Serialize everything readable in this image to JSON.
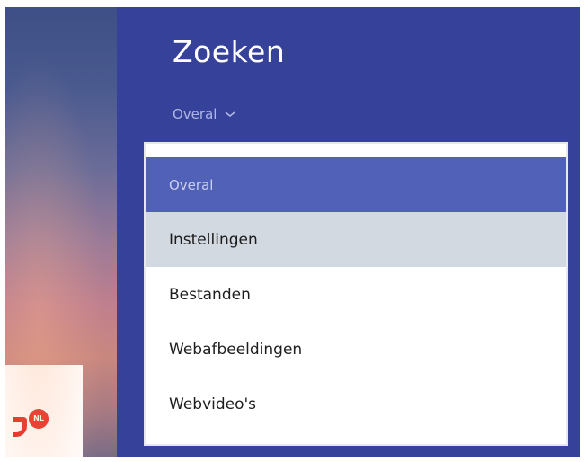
{
  "charm": {
    "title": "Zoeken",
    "scope_label": "Overal",
    "scope_icon": "chevron-down-icon"
  },
  "dropdown": {
    "options": [
      {
        "label": "Overal",
        "state": "selected"
      },
      {
        "label": "Instellingen",
        "state": "hover"
      },
      {
        "label": "Bestanden",
        "state": "normal"
      },
      {
        "label": "Webafbeeldingen",
        "state": "normal"
      },
      {
        "label": "Webvideo's",
        "state": "normal"
      }
    ]
  },
  "tile": {
    "badge": "NL"
  },
  "colors": {
    "charm_background": "#36419a",
    "selected_option": "#5261b8",
    "hover_option": "#d3d9e0",
    "tile_accent": "#e2231a"
  }
}
